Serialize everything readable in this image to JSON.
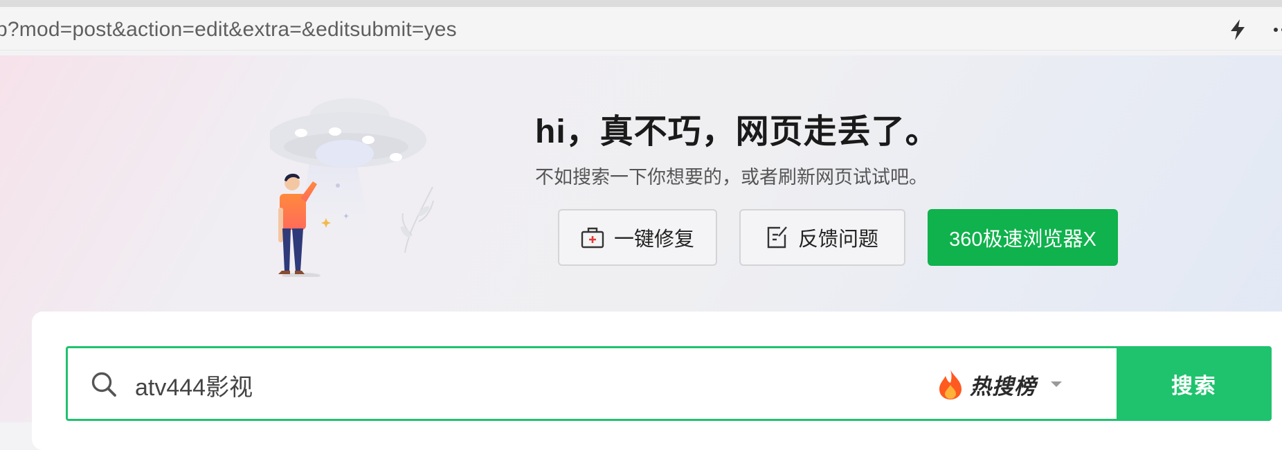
{
  "browser": {
    "url": "p?mod=post&action=edit&extra=&editsubmit=yes",
    "icons": [
      "bolt-icon",
      "more-icon"
    ]
  },
  "error_page": {
    "headline": "hi，真不巧，网页走丢了。",
    "subtext": "不如搜索一下你想要的，或者刷新网页试试吧。",
    "buttons": {
      "repair": "一键修复",
      "feedback": "反馈问题",
      "browser": "360极速浏览器X"
    },
    "accent_green": "#0fb24c"
  },
  "search": {
    "query": "atv444影视",
    "hot_label": "热搜榜",
    "button": "搜索",
    "border_color": "#1fc26d"
  }
}
